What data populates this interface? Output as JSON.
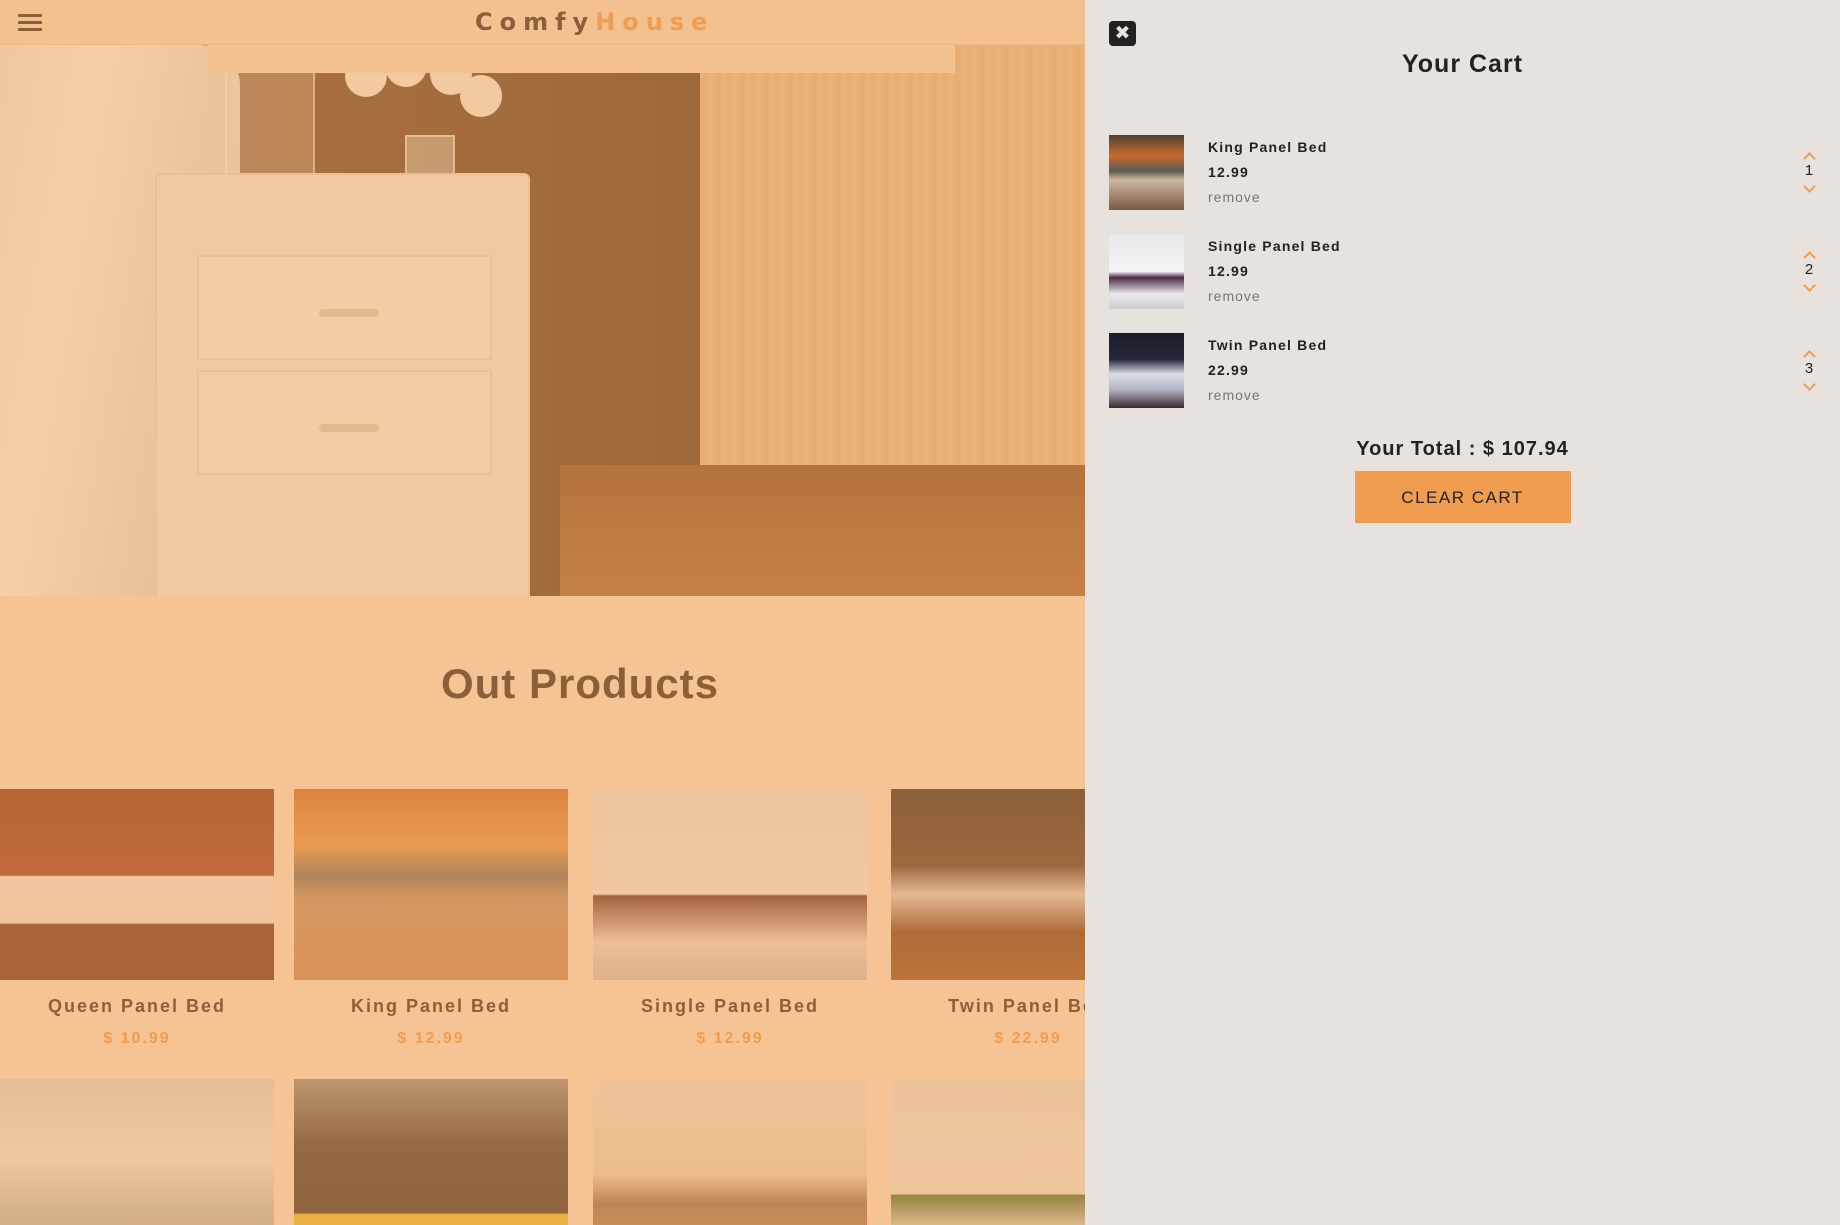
{
  "navbar": {
    "logo_part1": "Comfy",
    "logo_part2": "House"
  },
  "main": {
    "section_title": "Out Products",
    "products": [
      {
        "name": "Queen Panel Bed",
        "price": "$ 10.99"
      },
      {
        "name": "King Panel Bed",
        "price": "$ 12.99"
      },
      {
        "name": "Single Panel Bed",
        "price": "$ 12.99"
      },
      {
        "name": "Twin Panel Bed",
        "price": "$ 22.99"
      }
    ]
  },
  "cart": {
    "title": "Your Cart",
    "close_icon": "close-icon",
    "items": [
      {
        "name": "King Panel Bed",
        "price": "12.99",
        "remove_label": "remove",
        "quantity": "1"
      },
      {
        "name": "Single Panel Bed",
        "price": "12.99",
        "remove_label": "remove",
        "quantity": "2"
      },
      {
        "name": "Twin Panel Bed",
        "price": "22.99",
        "remove_label": "remove",
        "quantity": "3"
      }
    ],
    "total_label": "Your Total : $ 107.94",
    "clear_label": "CLEAR CART"
  },
  "colors": {
    "accent": "#f09d51",
    "overlay": "rgba(240,157,81,0.5)",
    "cart_background": "#e7e2dd",
    "text": "#222222"
  }
}
